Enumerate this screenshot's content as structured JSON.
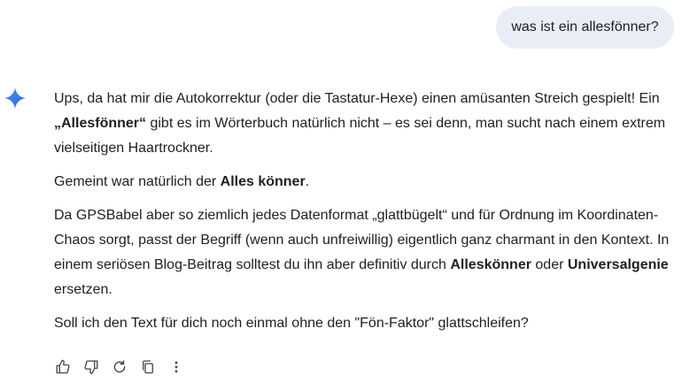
{
  "user_message": {
    "text": "was ist ein allesfönner?"
  },
  "reply": {
    "p1": {
      "t1": "Ups, da hat mir die Autokorrektur (oder die Tastatur-Hexe) einen amüsanten Streich gespielt! Ein ",
      "b1": "„Allesfönner“",
      "t2": " gibt es im Wörterbuch natürlich nicht – es sei denn, man sucht nach einem extrem vielseitigen Haartrockner."
    },
    "p2": {
      "t1": "Gemeint war natürlich der ",
      "b1": "Alles könner",
      "t2": "."
    },
    "p3": {
      "t1": "Da GPSBabel aber so ziemlich jedes Datenformat „glattbügelt“ und für Ordnung im Koordinaten-Chaos sorgt, passt der Begriff (wenn auch unfreiwillig) eigentlich ganz charmant in den Kontext. In einem seriösen Blog-Beitrag solltest du ihn aber definitiv durch ",
      "b1": "Alleskönner",
      "t2": " oder ",
      "b2": "Universalgenie",
      "t3": " ersetzen."
    },
    "p4": {
      "t1": "Soll ich den Text für dich noch einmal ohne den \"Fön-Faktor\" glattschleifen?"
    }
  },
  "actions": [
    {
      "icon": "thumbs-up-icon"
    },
    {
      "icon": "thumbs-down-icon"
    },
    {
      "icon": "regenerate-icon"
    },
    {
      "icon": "copy-icon"
    },
    {
      "icon": "more-vert-icon"
    }
  ],
  "colors": {
    "text": "#1f1f1f",
    "bubble": "#e9eef6",
    "icon": "#444746",
    "spark": "#4285f4"
  }
}
